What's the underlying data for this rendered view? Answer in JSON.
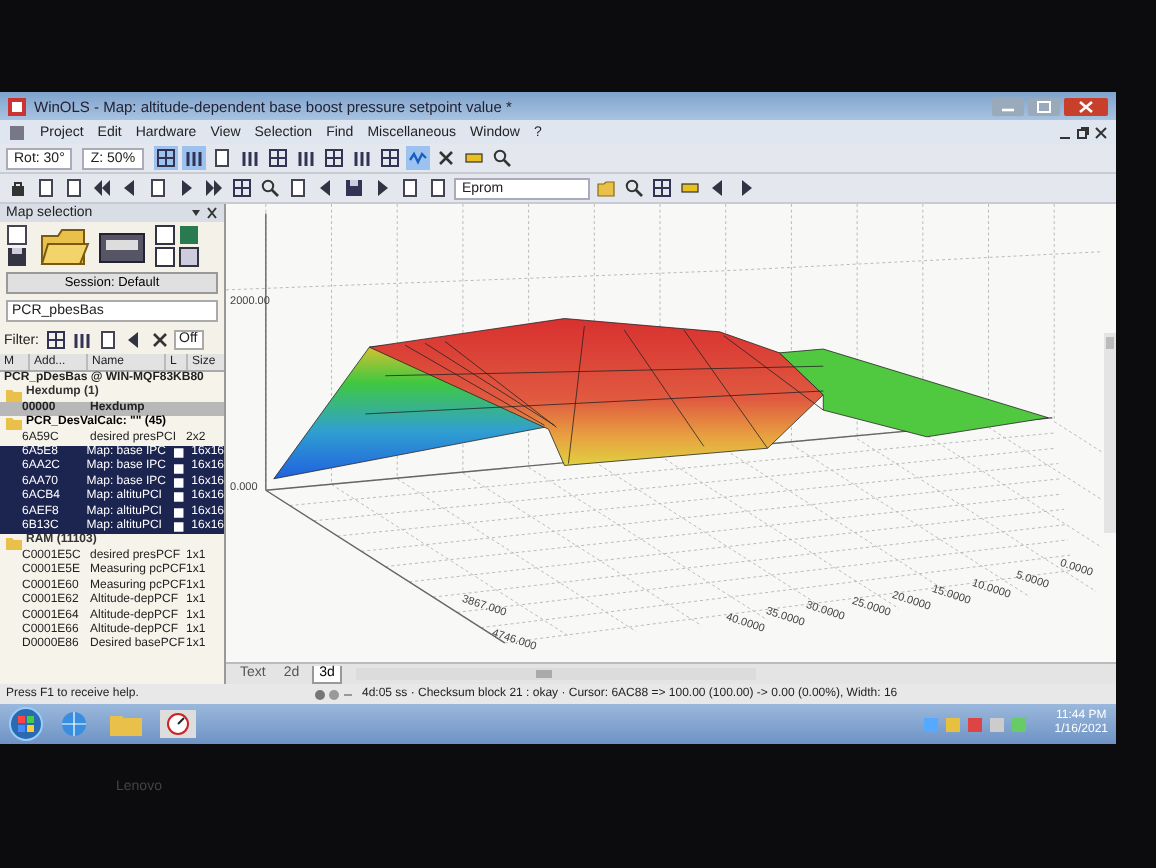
{
  "window": {
    "title": "WinOLS - Map: altitude-dependent base boost pressure setpoint value *"
  },
  "menu": [
    "Project",
    "Edit",
    "Hardware",
    "View",
    "Selection",
    "Find",
    "Miscellaneous",
    "Window",
    "?"
  ],
  "toolbar": {
    "rotation": "Rot: 30°",
    "zoom": "Z: 50%",
    "view_dropdown": "Eprom"
  },
  "map_selection": {
    "title": "Map selection",
    "session_button": "Session: Default",
    "project_dropdown": "PCR_pbesBas",
    "filter_label": "Filter:",
    "filter_dropdown": "Off",
    "columns": [
      "M",
      "Add...",
      "Name",
      "L",
      "Size"
    ],
    "root": "PCR_pDesBas @ WIN-MQF83KB80",
    "groups": [
      {
        "label": "Hexdump (1)",
        "active": false,
        "children": [
          {
            "kind": "plain",
            "address": "00000",
            "name": "Hexdump",
            "selected": true
          }
        ]
      },
      {
        "label": "PCR_DesValCalc: \"\" (45)",
        "active": true,
        "children": [
          {
            "kind": "plain",
            "address": "6A59C",
            "name": "desired presPCI",
            "size": "2x2",
            "selected": false
          },
          {
            "kind": "map",
            "address": "6A5E8",
            "name": "Map: base IPC",
            "size": "16x16",
            "selected": true
          },
          {
            "kind": "map",
            "address": "6AA2C",
            "name": "Map: base IPC",
            "size": "16x16",
            "selected": true
          },
          {
            "kind": "map",
            "address": "6AA70",
            "name": "Map: base IPC",
            "size": "16x16",
            "selected": true
          },
          {
            "kind": "map",
            "address": "6ACB4",
            "name": "Map: altituPCI",
            "size": "16x16",
            "selected": true
          },
          {
            "kind": "map",
            "address": "6AEF8",
            "name": "Map: altituPCI",
            "size": "16x16",
            "selected": true
          },
          {
            "kind": "map",
            "address": "6B13C",
            "name": "Map: altituPCI",
            "size": "16x16",
            "selected": true
          }
        ]
      },
      {
        "label": "RAM (11103)",
        "active": false,
        "children": [
          {
            "kind": "plain",
            "address": "C0001E5C",
            "name": "desired presPCF",
            "size": "1x1",
            "selected": false
          },
          {
            "kind": "plain",
            "address": "C0001E5E",
            "name": "Measuring pcPCF",
            "size": "1x1",
            "selected": false
          },
          {
            "kind": "plain",
            "address": "C0001E60",
            "name": "Measuring pcPCF",
            "size": "1x1",
            "selected": false
          },
          {
            "kind": "plain",
            "address": "C0001E62",
            "name": "Altitude-depPCF",
            "size": "1x1",
            "selected": false
          },
          {
            "kind": "plain",
            "address": "C0001E64",
            "name": "Altitude-depPCF",
            "size": "1x1",
            "selected": false
          },
          {
            "kind": "plain",
            "address": "C0001E66",
            "name": "Altitude-depPCF",
            "size": "1x1",
            "selected": false
          },
          {
            "kind": "plain",
            "address": "D0000E86",
            "name": "Desired basePCF",
            "size": "1x1",
            "selected": false
          }
        ]
      }
    ]
  },
  "plot": {
    "z_labels": [
      "2000.00",
      "0.000"
    ],
    "x_labels": [
      "0.0000",
      "5.0000",
      "10.0000",
      "15.0000",
      "20.0000",
      "25.0000",
      "30.0000",
      "35.0000",
      "40.0000"
    ],
    "y_labels": [
      "3867.000",
      "4746.000"
    ]
  },
  "view_tabs": [
    {
      "label": "Text",
      "selected": false
    },
    {
      "label": "2d",
      "selected": false
    },
    {
      "label": "3d",
      "selected": true
    }
  ],
  "status_bar": {
    "help": "Press F1 to receive help.",
    "info": "4d:05 ss · Checksum block 21 : okay · Cursor: 6AC88 => 100.00 (100.00) -> 0.00 (0.00%), Width: 16"
  },
  "taskbar": {
    "time": "11:44 PM",
    "date": "1/16/2021"
  },
  "bezel": {
    "brand": "Lenovo"
  }
}
